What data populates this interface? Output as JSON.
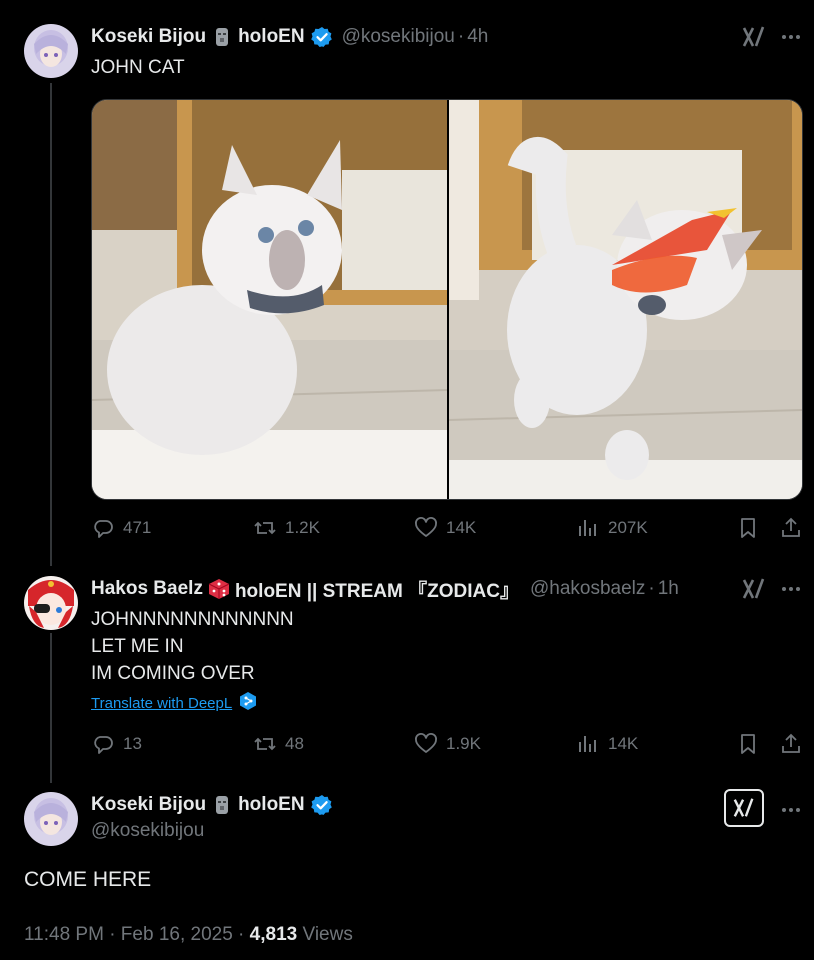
{
  "tweets": [
    {
      "display_name": "Koseki Bijou",
      "org": "holoEN",
      "handle": "@kosekibijou",
      "time": "4h",
      "text": "JOHN CAT",
      "stats": {
        "replies": "471",
        "reposts": "1.2K",
        "likes": "14K",
        "views": "207K"
      }
    },
    {
      "display_name": "Hakos Baelz",
      "org": "holoEN || STREAM 『ZODIAC』",
      "handle": "@hakosbaelz",
      "time": "1h",
      "text": "JOHNNNNNNNNNNNN\nLET ME IN\nIM COMING OVER",
      "translate_label": "Translate with DeepL",
      "stats": {
        "replies": "13",
        "reposts": "48",
        "likes": "1.9K",
        "views": "14K"
      }
    }
  ],
  "focused": {
    "display_name": "Koseki Bijou",
    "org": "holoEN",
    "handle": "@kosekibijou",
    "text": "COME HERE",
    "timestamp": "11:48 PM · Feb 16, 2025 · ",
    "views_count": "4,813",
    "views_label": "Views"
  },
  "separators": {
    "dot": "·"
  },
  "icons": {
    "verified": "verified-badge-icon",
    "grok": "grok-icon",
    "more": "more-icon",
    "reply": "reply-icon",
    "repost": "repost-icon",
    "like": "like-icon",
    "views": "views-icon",
    "bookmark": "bookmark-icon",
    "share": "share-icon"
  },
  "colors": {
    "accent": "#1d9bf0",
    "muted": "#71767b",
    "text": "#e7e9ea",
    "background": "#000000"
  }
}
